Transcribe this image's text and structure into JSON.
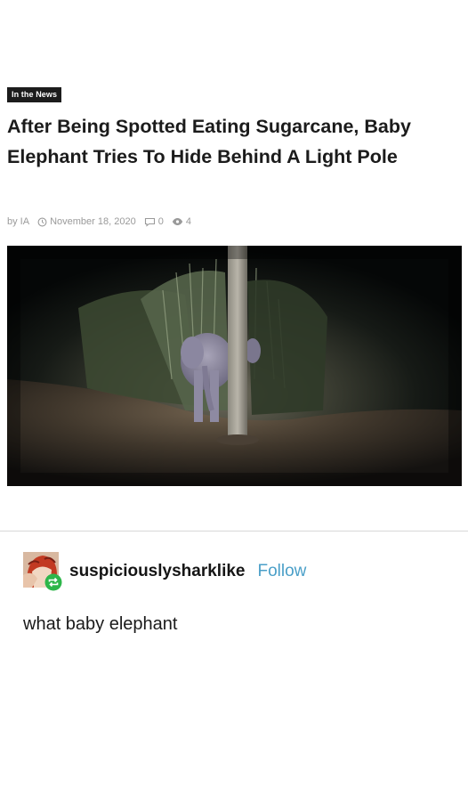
{
  "article": {
    "badge": "In the News",
    "headline": "After Being Spotted Eating Sugarcane, Baby Elephant Tries To Hide Behind A Light Pole",
    "author": "by IA",
    "date": "November 18, 2020",
    "comments_count": "0",
    "views_count": "4",
    "photo_icon": "photo-elephant-behind-pole"
  },
  "post": {
    "username": "suspiciouslysharklike",
    "follow_label": "Follow",
    "text": "what baby elephant",
    "reblog_icon": "reblog-icon"
  },
  "colors": {
    "follow": "#4a9fc8",
    "reblog_badge": "#2db64a",
    "badge_bg": "#1c1c1c",
    "meta_text": "#9a9a9a"
  }
}
